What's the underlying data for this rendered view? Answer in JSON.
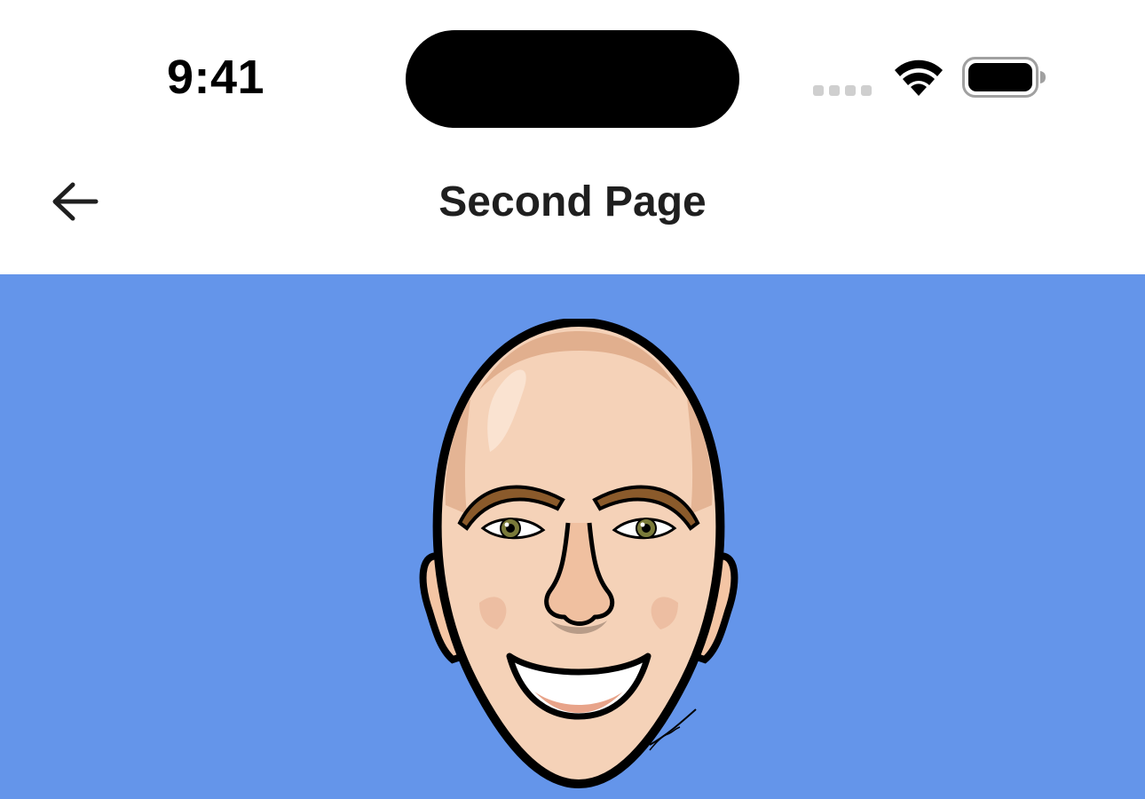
{
  "status_bar": {
    "time": "9:41"
  },
  "nav": {
    "title": "Second Page",
    "back_icon": "arrow-left-icon"
  },
  "content": {
    "background_color": "#6495ea",
    "avatar_icon": "caricature-face-avatar"
  }
}
